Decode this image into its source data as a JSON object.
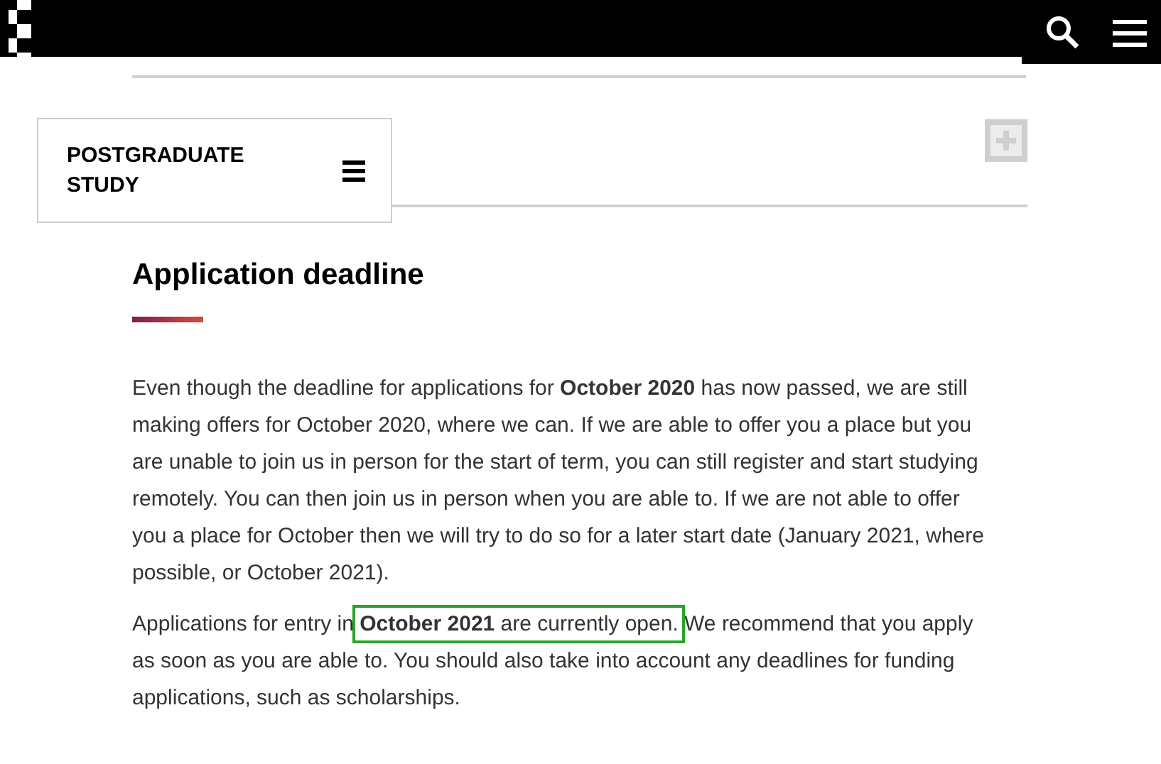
{
  "section_menu": {
    "title": "POSTGRADUATE STUDY"
  },
  "heading": "Application deadline",
  "paragraphs": [
    {
      "before": "Even though the deadline for applications for **October 2020** has now passed, we are still making offers for October 2020, where we can. If we are able to offer you a place but you are unable to join us in person for the start of term, you can still register and start studying remotely. You can then join us in person when you are able to. If we are not able to offer you a place for October then we will try to do so for a later start date (January 2021, where possible, or October 2021)."
    },
    {
      "before": "Applications for entry in ",
      "highlight": "**October 2021** are currently open.",
      "after": " We recommend that you apply as soon as you are able to. You should also take into account any deadlines for funding applications, such as scholarships."
    }
  ]
}
